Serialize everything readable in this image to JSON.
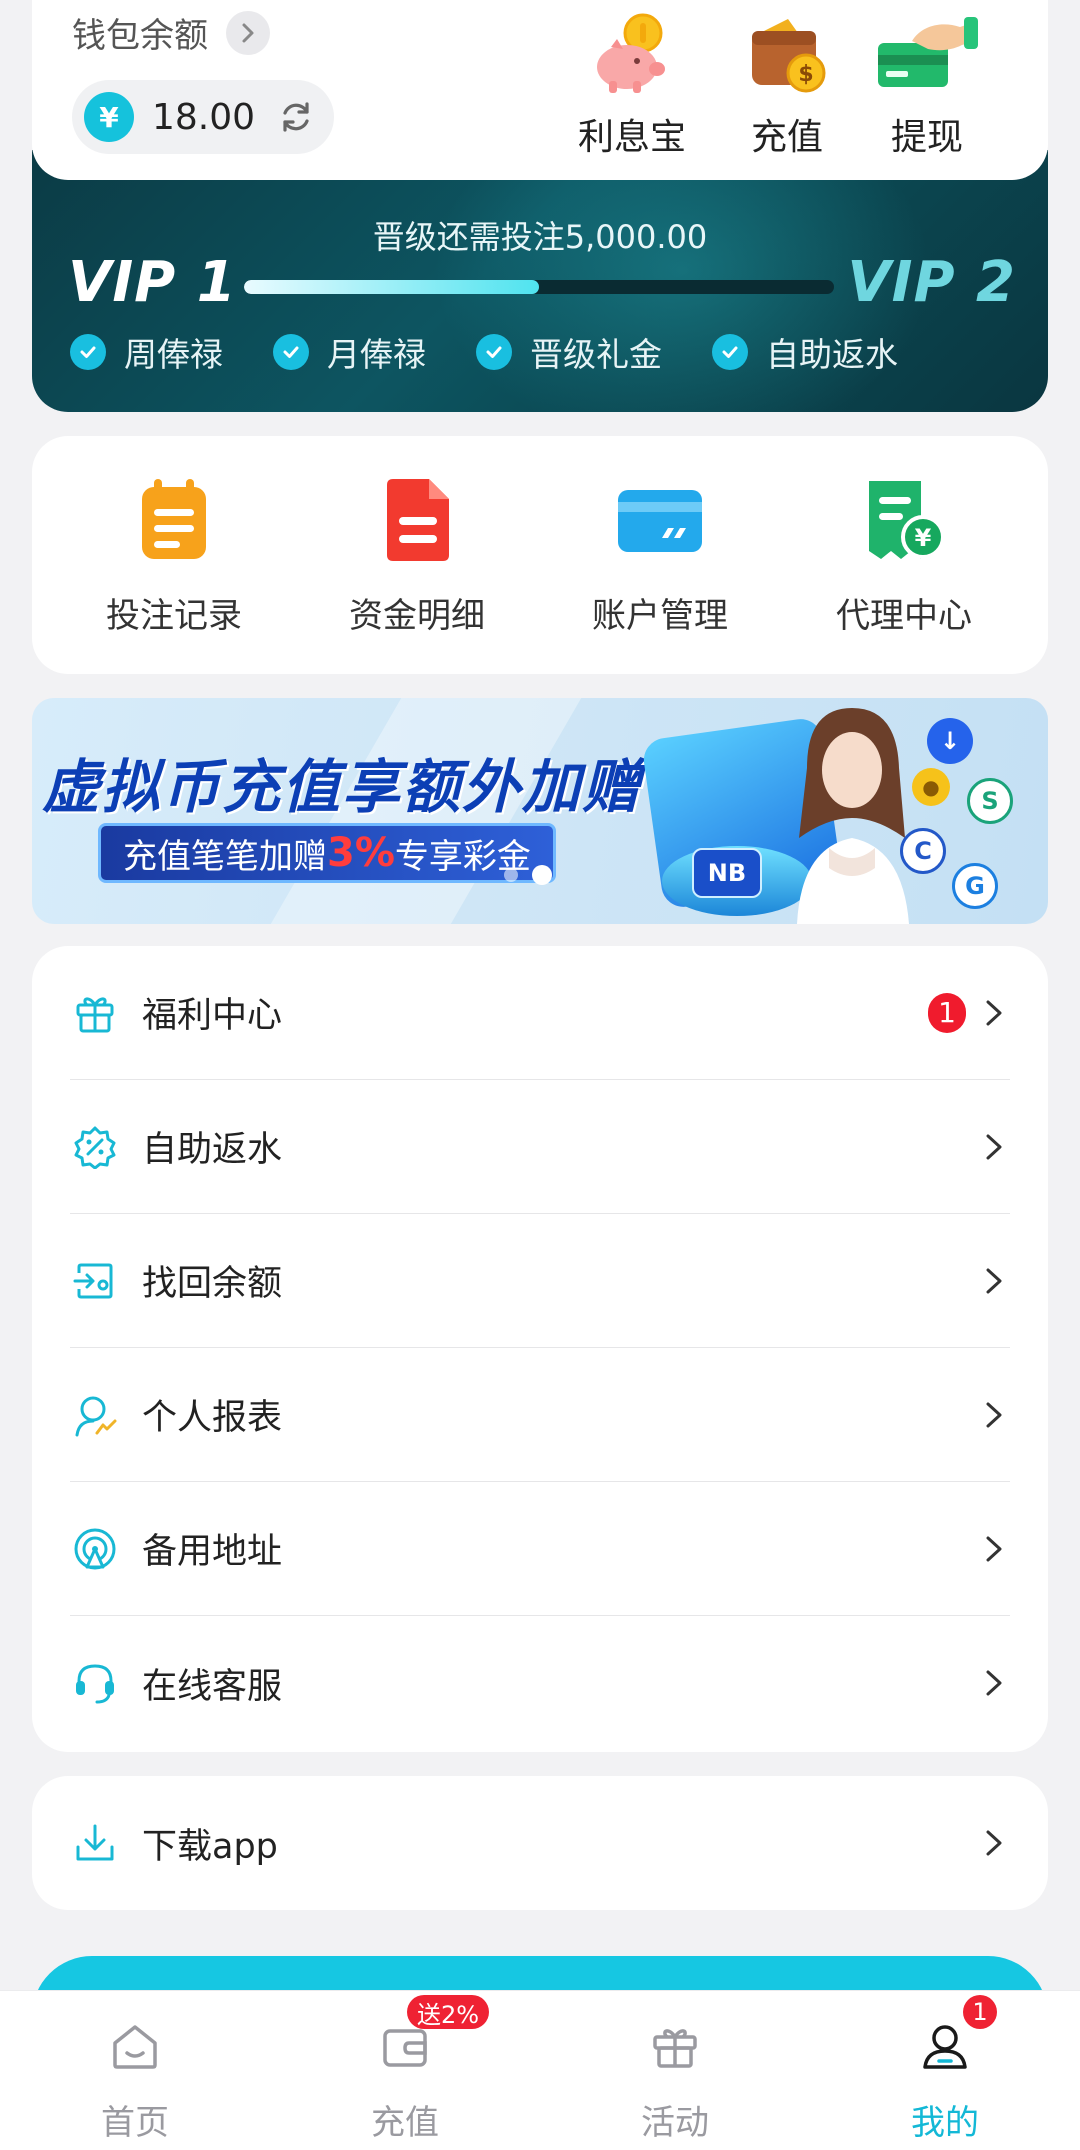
{
  "wallet": {
    "title": "钱包余额",
    "currency_symbol": "¥",
    "balance": "18.00"
  },
  "quick_actions": [
    {
      "label": "利息宝",
      "icon": "piggy-bank-icon"
    },
    {
      "label": "充值",
      "icon": "wallet-coin-icon"
    },
    {
      "label": "提现",
      "icon": "card-hand-icon"
    }
  ],
  "vip": {
    "need_text": "晋级还需投注5,000.00",
    "current_level": "VIP 1",
    "next_level": "VIP 2",
    "progress": 0.5,
    "perks": [
      "周俸禄",
      "月俸禄",
      "晋级礼金",
      "自助返水"
    ]
  },
  "shortcuts": [
    {
      "label": "投注记录",
      "icon": "clipboard-icon",
      "color": "#f7a21b"
    },
    {
      "label": "资金明细",
      "icon": "document-icon",
      "color": "#f23a2f"
    },
    {
      "label": "账户管理",
      "icon": "bank-card-icon",
      "color": "#23a9ec"
    },
    {
      "label": "代理中心",
      "icon": "receipt-yen-icon",
      "color": "#1fb36b"
    }
  ],
  "promo": {
    "headline": "虚拟币充值享额外加赠",
    "sub_before": "充值笔笔加赠",
    "sub_highlight": "3%",
    "sub_after": "专享彩金",
    "badge_text": "NB"
  },
  "menu": [
    {
      "label": "福利中心",
      "icon": "gift-icon",
      "badge": "1"
    },
    {
      "label": "自助返水",
      "icon": "percent-badge-icon",
      "badge": ""
    },
    {
      "label": "找回余额",
      "icon": "wallet-transfer-icon",
      "badge": ""
    },
    {
      "label": "个人报表",
      "icon": "user-chart-icon",
      "badge": ""
    },
    {
      "label": "备用地址",
      "icon": "signal-tower-icon",
      "badge": ""
    },
    {
      "label": "在线客服",
      "icon": "headset-icon",
      "badge": ""
    }
  ],
  "download": {
    "label": "下载app",
    "icon": "download-icon"
  },
  "bottom_nav": [
    {
      "label": "首页",
      "icon": "home-icon",
      "badge": ""
    },
    {
      "label": "充值",
      "icon": "wallet-icon",
      "badge": "送2%"
    },
    {
      "label": "活动",
      "icon": "gift-box-icon",
      "badge": ""
    },
    {
      "label": "我的",
      "icon": "profile-icon",
      "badge": "1",
      "active": true
    }
  ],
  "colors": {
    "accent": "#13b8d6",
    "badge_red": "#ef2233",
    "vip_dark": "#0b3b45"
  }
}
